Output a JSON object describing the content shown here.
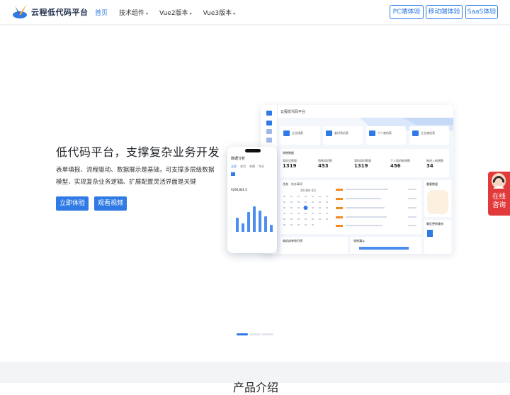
{
  "header": {
    "logo_text": "云程低代码平台",
    "nav": [
      {
        "label": "首页",
        "caret": false
      },
      {
        "label": "技术组件",
        "caret": true
      },
      {
        "label": "Vue2版本",
        "caret": true
      },
      {
        "label": "Vue3版本",
        "caret": true
      }
    ],
    "buttons": [
      "PC端体验",
      "移动端体验",
      "SaaS体验"
    ]
  },
  "hero": {
    "title": "低代码平台，支撑复杂业务开发",
    "description": "表单填报、流程驱动、数据展示是基础，可支撑多层级数据模型、实现复杂业务逻辑、扩展配置灵活界面是关键",
    "primary_button": "立即体验",
    "secondary_button": "观看视频"
  },
  "dashboard_mock": {
    "app_title": "云程低代码平台",
    "cards": [
      "企业搜索",
      "临时表机表",
      "个人感机表",
      "企业感机表"
    ],
    "section_title": "销售数据",
    "stats": [
      {
        "label": "商机总数量",
        "value": "1319"
      },
      {
        "label": "销售商机数",
        "value": "453"
      },
      {
        "label": "我的商机数量",
        "value": "1319"
      },
      {
        "label": "个人商机新增数",
        "value": "456"
      },
      {
        "label": "新进入新增数",
        "value": "34"
      }
    ],
    "calendar_tabs": [
      "任务",
      "待办事项"
    ],
    "calendar_month": "2018年 6月",
    "bottom_panels": [
      "商机成单排行榜",
      "销售漏斗"
    ],
    "right_panels": [
      "重要数据",
      "最近更新维修"
    ]
  },
  "phone_mock": {
    "title": "数据分析",
    "tabs": [
      "全部",
      "本月",
      "本周",
      "今天"
    ],
    "amount": "¥296,861.0"
  },
  "carousel": {
    "slides": 3,
    "active_index": 0
  },
  "bottom_section": {
    "title": "产品介绍"
  },
  "chat_widget": {
    "label_line1": "在线",
    "label_line2": "咨询"
  },
  "colors": {
    "accent": "#2f7ae5",
    "chat": "#e23a3a"
  }
}
